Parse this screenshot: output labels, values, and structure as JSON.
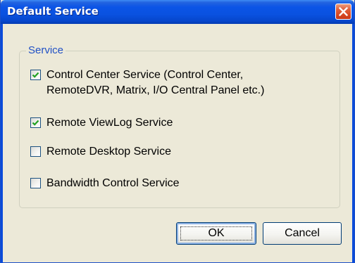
{
  "window": {
    "title": "Default Service"
  },
  "group": {
    "label": "Service"
  },
  "options": [
    {
      "label": "Control Center Service (Control Center,\nRemoteDVR, Matrix, I/O Central Panel etc.)",
      "checked": true
    },
    {
      "label": "Remote ViewLog Service",
      "checked": true
    },
    {
      "label": "Remote Desktop Service",
      "checked": false
    },
    {
      "label": "Bandwidth Control Service",
      "checked": false
    }
  ],
  "buttons": {
    "ok": "OK",
    "cancel": "Cancel"
  },
  "colors": {
    "check_mark": "#21A121",
    "group_label": "#2151C5",
    "title_bar": "#0A52E0",
    "close_button": "#D5441E"
  }
}
